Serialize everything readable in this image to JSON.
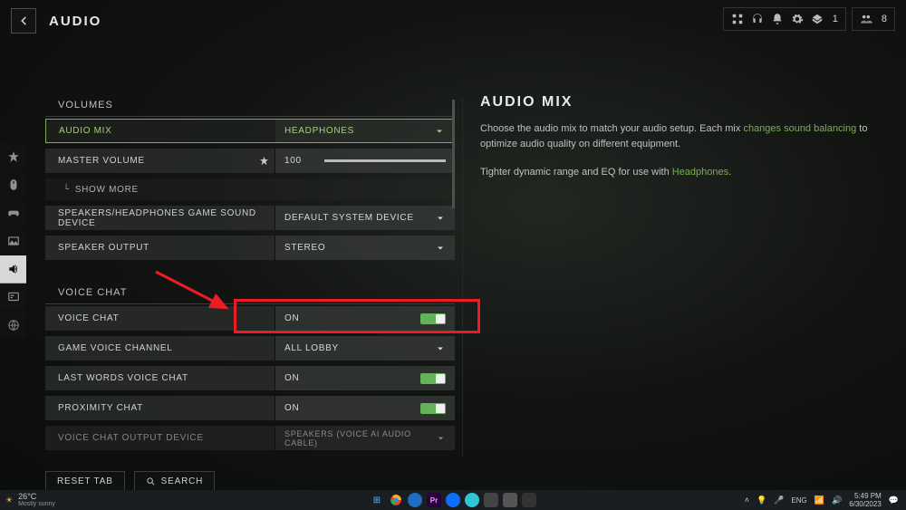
{
  "header": {
    "title": "AUDIO"
  },
  "topStatus": {
    "player_count": "1",
    "party_count": "8"
  },
  "sections": {
    "volumes": {
      "title": "VOLUMES",
      "audio_mix": {
        "label": "AUDIO MIX",
        "value": "HEADPHONES"
      },
      "master_volume": {
        "label": "MASTER VOLUME",
        "value": "100"
      },
      "show_more": "SHOW MORE",
      "sound_device": {
        "label": "SPEAKERS/HEADPHONES GAME SOUND DEVICE",
        "value": "DEFAULT SYSTEM DEVICE"
      },
      "speaker_output": {
        "label": "SPEAKER OUTPUT",
        "value": "STEREO"
      }
    },
    "voice": {
      "title": "VOICE CHAT",
      "voice_chat": {
        "label": "VOICE CHAT",
        "value": "ON"
      },
      "game_voice_channel": {
        "label": "GAME VOICE CHANNEL",
        "value": "ALL LOBBY"
      },
      "last_words": {
        "label": "LAST WORDS VOICE CHAT",
        "value": "ON"
      },
      "proximity": {
        "label": "PROXIMITY CHAT",
        "value": "ON"
      },
      "output_device": {
        "label": "VOICE CHAT OUTPUT DEVICE",
        "value": "SPEAKERS (VOICE AI AUDIO CABLE)"
      }
    }
  },
  "info": {
    "title": "AUDIO MIX",
    "p1_a": "Choose the audio mix to match your audio setup. Each mix ",
    "p1_link": "changes sound balancing",
    "p1_b": " to optimize audio quality on different equipment.",
    "p2_a": "Tighter dynamic range and EQ for use with ",
    "p2_link": "Headphones",
    "p2_b": "."
  },
  "bottom": {
    "reset": "RESET TAB",
    "search": "SEARCH"
  },
  "taskbar": {
    "weather_temp": "26°C",
    "weather_desc": "Mostly sunny",
    "lang": "ENG",
    "time": "5:49 PM",
    "date": "6/30/2023"
  }
}
